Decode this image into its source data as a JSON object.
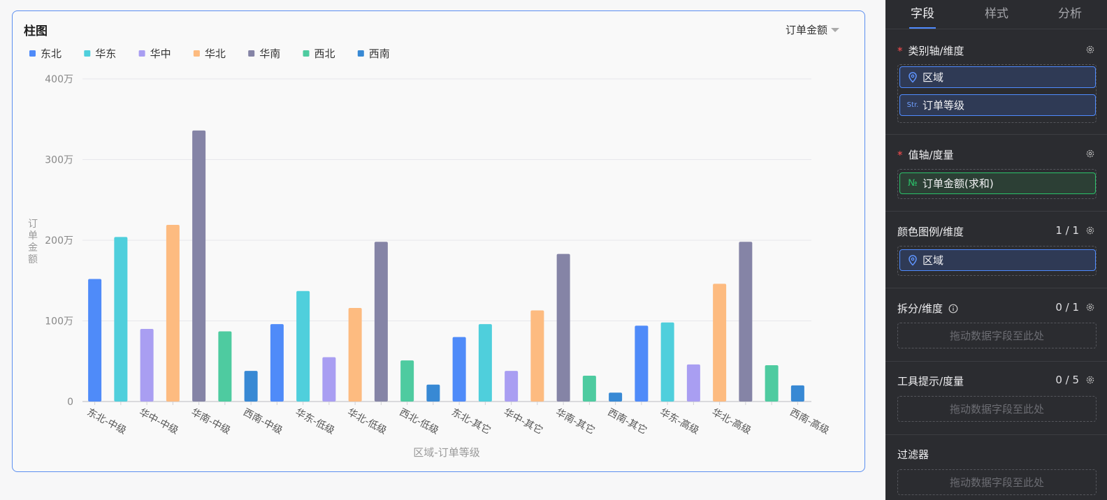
{
  "card": {
    "title": "柱图",
    "measure_select": "订单金额"
  },
  "chart_data": {
    "type": "bar",
    "ylabel": "订单金额",
    "xlabel": "区域-订单等级",
    "ylim": [
      0,
      4000000
    ],
    "yticks": [
      {
        "value": 0,
        "label": "0"
      },
      {
        "value": 1000000,
        "label": "100万"
      },
      {
        "value": 2000000,
        "label": "200万"
      },
      {
        "value": 3000000,
        "label": "300万"
      },
      {
        "value": 4000000,
        "label": "400万"
      }
    ],
    "grid": true,
    "legend_position": "top-left",
    "legend": [
      {
        "name": "东北",
        "color": "#4f8bf9"
      },
      {
        "name": "华东",
        "color": "#4fcfdc"
      },
      {
        "name": "华中",
        "color": "#a99ef2"
      },
      {
        "name": "华北",
        "color": "#fdbb80"
      },
      {
        "name": "华南",
        "color": "#8584a6"
      },
      {
        "name": "西北",
        "color": "#4ecba0"
      },
      {
        "name": "西南",
        "color": "#3889d4"
      }
    ],
    "bars": [
      {
        "category": "东北-中级",
        "region": "东北",
        "value": 1520000
      },
      {
        "category": "华东-中级",
        "region": "华东",
        "value": 2040000
      },
      {
        "category": "华中-中级",
        "region": "华中",
        "value": 900000
      },
      {
        "category": "华北-中级",
        "region": "华北",
        "value": 2190000
      },
      {
        "category": "华南-中级",
        "region": "华南",
        "value": 3360000
      },
      {
        "category": "西北-中级",
        "region": "西北",
        "value": 870000
      },
      {
        "category": "西南-中级",
        "region": "西南",
        "value": 380000
      },
      {
        "category": "东北-低级",
        "region": "东北",
        "value": 960000
      },
      {
        "category": "华东-低级",
        "region": "华东",
        "value": 1370000
      },
      {
        "category": "华中-低级",
        "region": "华中",
        "value": 550000
      },
      {
        "category": "华北-低级",
        "region": "华北",
        "value": 1160000
      },
      {
        "category": "华南-低级",
        "region": "华南",
        "value": 1980000
      },
      {
        "category": "西北-低级",
        "region": "西北",
        "value": 510000
      },
      {
        "category": "西南-低级",
        "region": "西南",
        "value": 210000
      },
      {
        "category": "东北-其它",
        "region": "东北",
        "value": 800000
      },
      {
        "category": "华东-其它",
        "region": "华东",
        "value": 960000
      },
      {
        "category": "华中-其它",
        "region": "华中",
        "value": 380000
      },
      {
        "category": "华北-其它",
        "region": "华北",
        "value": 1130000
      },
      {
        "category": "华南-其它",
        "region": "华南",
        "value": 1830000
      },
      {
        "category": "西北-其它",
        "region": "西北",
        "value": 320000
      },
      {
        "category": "西南-其它",
        "region": "西南",
        "value": 110000
      },
      {
        "category": "东北-高级",
        "region": "东北",
        "value": 940000
      },
      {
        "category": "华东-高级",
        "region": "华东",
        "value": 980000
      },
      {
        "category": "华中-高级",
        "region": "华中",
        "value": 460000
      },
      {
        "category": "华北-高级",
        "region": "华北",
        "value": 1460000
      },
      {
        "category": "华南-高级",
        "region": "华南",
        "value": 1980000
      },
      {
        "category": "西北-高级",
        "region": "西北",
        "value": 450000
      },
      {
        "category": "西南-高级",
        "region": "西南",
        "value": 200000
      }
    ],
    "visible_tick_labels": [
      "东北-中级",
      "华中-中级",
      "华南-中级",
      "西南-中级",
      "华东-低级",
      "华北-低级",
      "西北-低级",
      "东北-其它",
      "华中-其它",
      "华南-其它",
      "西南-其它",
      "华东-高级",
      "华北-高级",
      "西南-高级"
    ]
  },
  "panel": {
    "tabs": [
      {
        "label": "字段"
      },
      {
        "label": "样式"
      },
      {
        "label": "分析"
      }
    ],
    "category_axis": {
      "title": "类别轴/维度",
      "required": "*",
      "fields": [
        {
          "label": "区域",
          "icon": "location-icon"
        },
        {
          "label": "订单等级",
          "icon_text": "Str."
        }
      ]
    },
    "value_axis": {
      "title": "值轴/度量",
      "required": "*",
      "fields": [
        {
          "label": "订单金额(求和)",
          "icon_text": "№"
        }
      ]
    },
    "color_legend": {
      "title": "颜色图例/维度",
      "count": "1 / 1",
      "fields": [
        {
          "label": "区域",
          "icon": "location-icon"
        }
      ]
    },
    "split": {
      "title": "拆分/维度",
      "count": "0 / 1",
      "placeholder": "拖动数据字段至此处"
    },
    "tooltip": {
      "title": "工具提示/度量",
      "count": "0 / 5",
      "placeholder": "拖动数据字段至此处"
    },
    "filter": {
      "title": "过滤器",
      "placeholder": "拖动数据字段至此处"
    },
    "colors": {
      "accent": "#4f8bff",
      "measure": "#2bc26a",
      "required": "#ff4d4f"
    }
  }
}
